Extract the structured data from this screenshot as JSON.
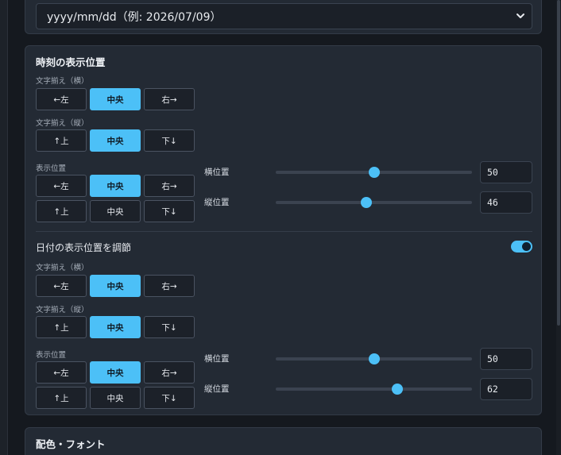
{
  "date_format": {
    "selected": "yyyy/mm/dd（例: 2026/07/09）"
  },
  "time_position": {
    "title": "時刻の表示位置",
    "h_align_label": "文字揃え（横）",
    "h_align": [
      {
        "arrow": "←",
        "text": "左"
      },
      {
        "arrow": "",
        "text": "中央"
      },
      {
        "arrow": "→",
        "text": "右",
        "arrow_after": true
      }
    ],
    "h_align_selected": "中央",
    "v_align_label": "文字揃え（縦）",
    "v_align": [
      {
        "arrow": "↑",
        "text": "上"
      },
      {
        "arrow": "",
        "text": "中央"
      },
      {
        "arrow": "↓",
        "text": "下",
        "arrow_after": true
      }
    ],
    "v_align_selected": "中央",
    "display_label": "表示位置",
    "display_row1": [
      "←左",
      "中央",
      "右→"
    ],
    "display_row2": [
      "↑上",
      "中央",
      "下↓"
    ],
    "display_selected": "中央",
    "h_pos_label": "横位置",
    "h_pos_value": "50",
    "v_pos_label": "縦位置",
    "v_pos_value": "46"
  },
  "date_position": {
    "adjust_label": "日付の表示位置を調節",
    "adjust_enabled": true,
    "h_align_label": "文字揃え（横）",
    "h_align_selected": "中央",
    "v_align_label": "文字揃え（縦）",
    "v_align_selected": "中央",
    "display_label": "表示位置",
    "display_selected": "中央",
    "h_pos_label": "横位置",
    "h_pos_value": "50",
    "v_pos_label": "縦位置",
    "v_pos_value": "62"
  },
  "labels": {
    "left": "←左",
    "center": "中央",
    "right": "右→",
    "up": "↑上",
    "down": "下↓"
  },
  "colors_font": {
    "title": "配色・フォント"
  },
  "accent": "#4cc0f7",
  "icons": {
    "select_chevron": "chevron-down-icon"
  }
}
